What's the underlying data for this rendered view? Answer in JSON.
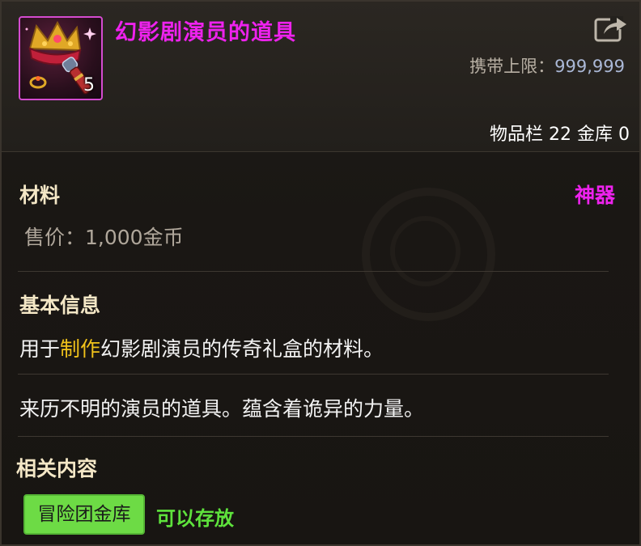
{
  "item": {
    "title": "幻影剧演员的道具",
    "count": "5",
    "carry_limit_label": "携带上限：",
    "carry_limit_value": "999,999",
    "storage_info": "物品栏 22 金库 0"
  },
  "details": {
    "category": "材料",
    "rarity": "神器",
    "price": "售价：1,000金币"
  },
  "basic_info": {
    "title": "基本信息",
    "usage_prefix": "用于",
    "usage_highlight": "制作",
    "usage_suffix": "幻影剧演员的传奇礼盒的材料。",
    "description": "来历不明的演员的道具。蕴含着诡异的力量。"
  },
  "related": {
    "title": "相关内容",
    "tag_label": "冒险团金库",
    "tag_status": "可以存放"
  },
  "colors": {
    "rarity": "#ee22ee",
    "highlight": "#f0c21a",
    "tag_bg": "#6ddb45",
    "status": "#5ee23c"
  },
  "icons": [
    "item-crown-icon",
    "share-icon"
  ]
}
